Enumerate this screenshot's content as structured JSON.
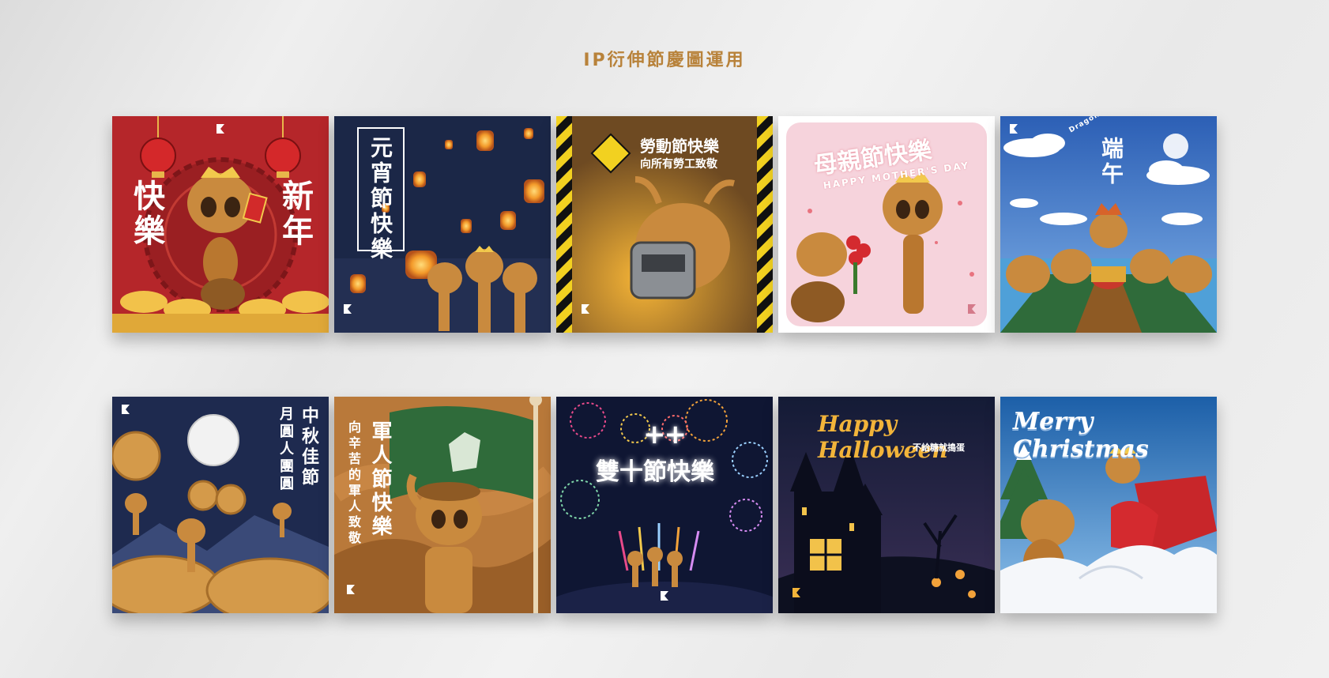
{
  "page": {
    "title": "IP衍伸節慶圖運用"
  },
  "cards": [
    {
      "name": "快樂新年",
      "left_text": "快樂",
      "right_text": "新年"
    },
    {
      "name": "元宵節快樂",
      "title": "元宵節快樂"
    },
    {
      "name": "勞動節快樂",
      "title": "勞動節快樂",
      "subtitle": "向所有勞工致敬"
    },
    {
      "name": "母親節快樂",
      "title": "母親節快樂",
      "subtitle": "HAPPY MOTHER'S DAY"
    },
    {
      "name": "端午",
      "title": "端午",
      "arc_text": "Dragon Boat Festival"
    },
    {
      "name": "中秋佳節",
      "title": "中秋佳節",
      "subtitle": "月圓人團圓"
    },
    {
      "name": "軍人節快樂",
      "title": "軍人節快樂",
      "subtitle": "向辛苦的軍人致敬"
    },
    {
      "name": "雙十節快樂",
      "title": "雙十節快樂",
      "mark": "++"
    },
    {
      "name": "Happy Halloween",
      "title": "Happy Halloween",
      "subtitle": "不給糖就搗蛋"
    },
    {
      "name": "Merry Christmas",
      "title": "Merry Christmas"
    }
  ],
  "colors": {
    "title": "#b8823a",
    "ant": "#c98a3e",
    "new_year_bg": "#b5262a",
    "lantern_bg": "#1b2747",
    "labor_bg": "#6e4a22",
    "mother_bg": "#f6d3dc",
    "dragon_bg": "#3d73c3",
    "moon_bg": "#1e2a4f",
    "army_bg": "#b9793a",
    "firework_bg": "#0f1633",
    "halloween_bg": "#17203d",
    "xmas_bg": "#1c5fa8"
  }
}
